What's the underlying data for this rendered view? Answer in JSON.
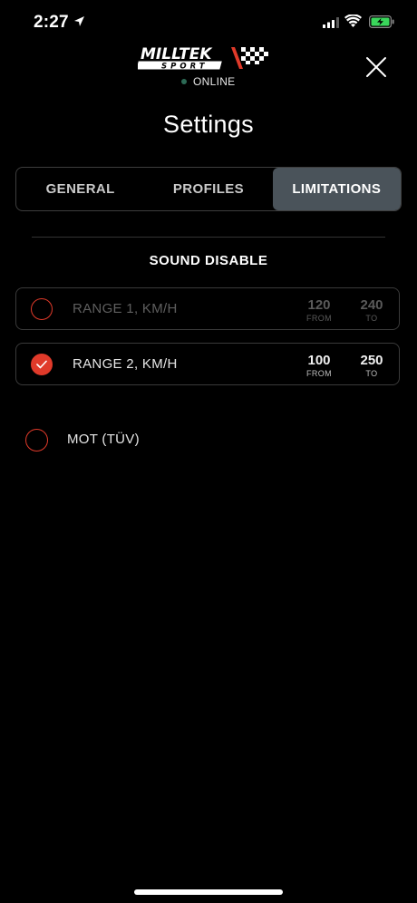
{
  "status_bar": {
    "time": "2:27",
    "icons": [
      "location-arrow-icon",
      "cellular-signal-icon",
      "wifi-icon",
      "battery-charging-icon"
    ]
  },
  "header": {
    "logo_text_top": "MILLTEK",
    "logo_text_bottom": "SPORT",
    "connection_status": "ONLINE",
    "close_icon": "close-icon"
  },
  "page": {
    "title": "Settings"
  },
  "tabs": [
    {
      "label": "GENERAL",
      "active": false
    },
    {
      "label": "PROFILES",
      "active": false
    },
    {
      "label": "LIMITATIONS",
      "active": true
    }
  ],
  "sound_disable": {
    "title": "SOUND DISABLE",
    "ranges": [
      {
        "label": "RANGE 1, KM/H",
        "checked": false,
        "from_value": "120",
        "from_caption": "FROM",
        "to_value": "240",
        "to_caption": "TO"
      },
      {
        "label": "RANGE 2, KM/H",
        "checked": true,
        "from_value": "100",
        "from_caption": "FROM",
        "to_value": "250",
        "to_caption": "TO"
      }
    ]
  },
  "mot": {
    "label": "MOT (TÜV)",
    "checked": false
  },
  "colors": {
    "accent_red": "#e03a2a",
    "active_tab": "#4a535a",
    "online_dot": "#2c6a55",
    "battery_green": "#3ad65b",
    "background": "#000000"
  }
}
